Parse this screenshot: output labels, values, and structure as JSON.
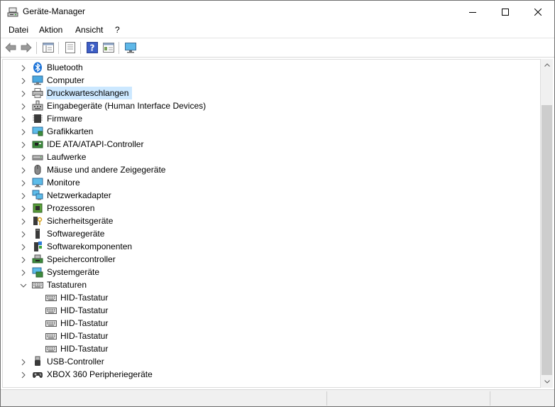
{
  "window": {
    "title": "Geräte-Manager"
  },
  "menu": [
    "Datei",
    "Aktion",
    "Ansicht",
    "?"
  ],
  "toolbar": [
    "back-icon",
    "forward-icon",
    "show-hide-console-tree-icon",
    "properties-icon",
    "help-icon",
    "action-pane-icon",
    "scan-hardware-icon"
  ],
  "tree": {
    "items": [
      {
        "label": "Bluetooth",
        "icon": "bluetooth-icon",
        "expanded": false
      },
      {
        "label": "Computer",
        "icon": "computer-icon",
        "expanded": false
      },
      {
        "label": "Druckwarteschlangen",
        "icon": "printer-icon",
        "expanded": false,
        "selected": true
      },
      {
        "label": "Eingabegeräte (Human Interface Devices)",
        "icon": "hid-icon",
        "expanded": false
      },
      {
        "label": "Firmware",
        "icon": "firmware-icon",
        "expanded": false
      },
      {
        "label": "Grafikkarten",
        "icon": "display-adapter-icon",
        "expanded": false
      },
      {
        "label": "IDE ATA/ATAPI-Controller",
        "icon": "ide-controller-icon",
        "expanded": false
      },
      {
        "label": "Laufwerke",
        "icon": "disk-drive-icon",
        "expanded": false
      },
      {
        "label": "Mäuse und andere Zeigegeräte",
        "icon": "mouse-icon",
        "expanded": false
      },
      {
        "label": "Monitore",
        "icon": "monitor-icon",
        "expanded": false
      },
      {
        "label": "Netzwerkadapter",
        "icon": "network-adapter-icon",
        "expanded": false
      },
      {
        "label": "Prozessoren",
        "icon": "processor-icon",
        "expanded": false
      },
      {
        "label": "Sicherheitsgeräte",
        "icon": "security-device-icon",
        "expanded": false
      },
      {
        "label": "Softwaregeräte",
        "icon": "software-device-icon",
        "expanded": false
      },
      {
        "label": "Softwarekomponenten",
        "icon": "software-component-icon",
        "expanded": false
      },
      {
        "label": "Speichercontroller",
        "icon": "storage-controller-icon",
        "expanded": false
      },
      {
        "label": "Systemgeräte",
        "icon": "system-device-icon",
        "expanded": false
      },
      {
        "label": "Tastaturen",
        "icon": "keyboard-icon",
        "expanded": true
      },
      {
        "label": "HID-Tastatur",
        "icon": "keyboard-icon",
        "child": true
      },
      {
        "label": "HID-Tastatur",
        "icon": "keyboard-icon",
        "child": true
      },
      {
        "label": "HID-Tastatur",
        "icon": "keyboard-icon",
        "child": true
      },
      {
        "label": "HID-Tastatur",
        "icon": "keyboard-icon",
        "child": true
      },
      {
        "label": "HID-Tastatur",
        "icon": "keyboard-icon",
        "child": true
      },
      {
        "label": "USB-Controller",
        "icon": "usb-icon",
        "expanded": false
      },
      {
        "label": "XBOX 360 Peripheriegeräte",
        "icon": "gamepad-icon",
        "expanded": false
      }
    ]
  },
  "colors": {
    "selection": "#cce8ff",
    "scrollbar_thumb": "#cdcdcd",
    "scrollbar_track": "#f0f0f0"
  }
}
